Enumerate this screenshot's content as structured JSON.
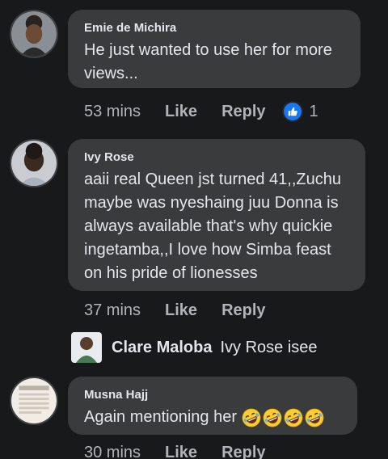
{
  "comments": [
    {
      "author": "Emie de Michira",
      "text_line1": "He just wanted to use her for more",
      "text_line2": "views...",
      "time": "53 mins",
      "like_label": "Like",
      "reply_label": "Reply",
      "reaction_count": "1",
      "reaction_icon": "thumbs-up-icon"
    },
    {
      "author": "Ivy Rose",
      "lines": [
        "aaii real Queen jst turned 41,,Zuchu",
        "maybe was nyeshaing juu Donna is",
        "always available that's why quickie",
        "ingetamba,,I love how Simba feast",
        "on his pride of lionesses"
      ],
      "time": "37 mins",
      "like_label": "Like",
      "reply_label": "Reply",
      "reply": {
        "author": "Clare Maloba",
        "text": "Ivy Rose isee"
      }
    },
    {
      "author": "Musna Hajj",
      "text": "Again mentioning her",
      "emoji_icon": "rolling-on-floor-laughing-emoji",
      "emoji_count": 4,
      "time": "30 mins",
      "like_label": "Like",
      "reply_label": "Reply"
    }
  ],
  "colors": {
    "background": "#18191a",
    "bubble": "#3a3b3c",
    "text": "#e4e6eb",
    "meta": "#b0b3b8",
    "like_blue": "#1877f2"
  }
}
